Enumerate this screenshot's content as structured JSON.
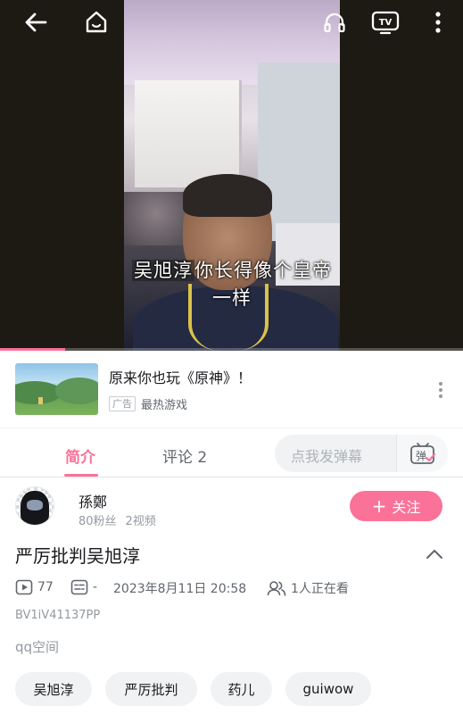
{
  "video": {
    "subtitle_name": "吴旭淳",
    "subtitle_line1_rest": "你长得像个皇帝",
    "subtitle_line2": "一样",
    "progress": 0.14
  },
  "top_bar": {
    "icons": [
      "back-arrow-icon",
      "home-icon",
      "headphones-icon",
      "tv-cast-icon",
      "more-vertical-icon"
    ]
  },
  "ad": {
    "title": "原来你也玩《原神》！",
    "badge": "广告",
    "source": "最热游戏"
  },
  "tabs": {
    "intro": "简介",
    "comments": "评论 2",
    "danmaku_placeholder": "点我发弹幕",
    "danmaku_button": "弹"
  },
  "uploader": {
    "name": "孫鄭",
    "fans": "80粉丝",
    "videos": "2视频",
    "follow_plus": "+",
    "follow_label": "关注"
  },
  "video_info": {
    "title": "严厉批判吴旭淳",
    "plays": "77",
    "danmaku_count": "-",
    "date": "2023年8月11日 20:58",
    "watching": "1人正在看",
    "bvid": "BV1iV41137PP",
    "description": "qq空间"
  },
  "tags": [
    "吴旭淳",
    "严厉批判",
    "药儿",
    "guiwow"
  ],
  "colors": {
    "accent": "#fb7299",
    "text": "#18191c",
    "muted": "#9499a0"
  }
}
